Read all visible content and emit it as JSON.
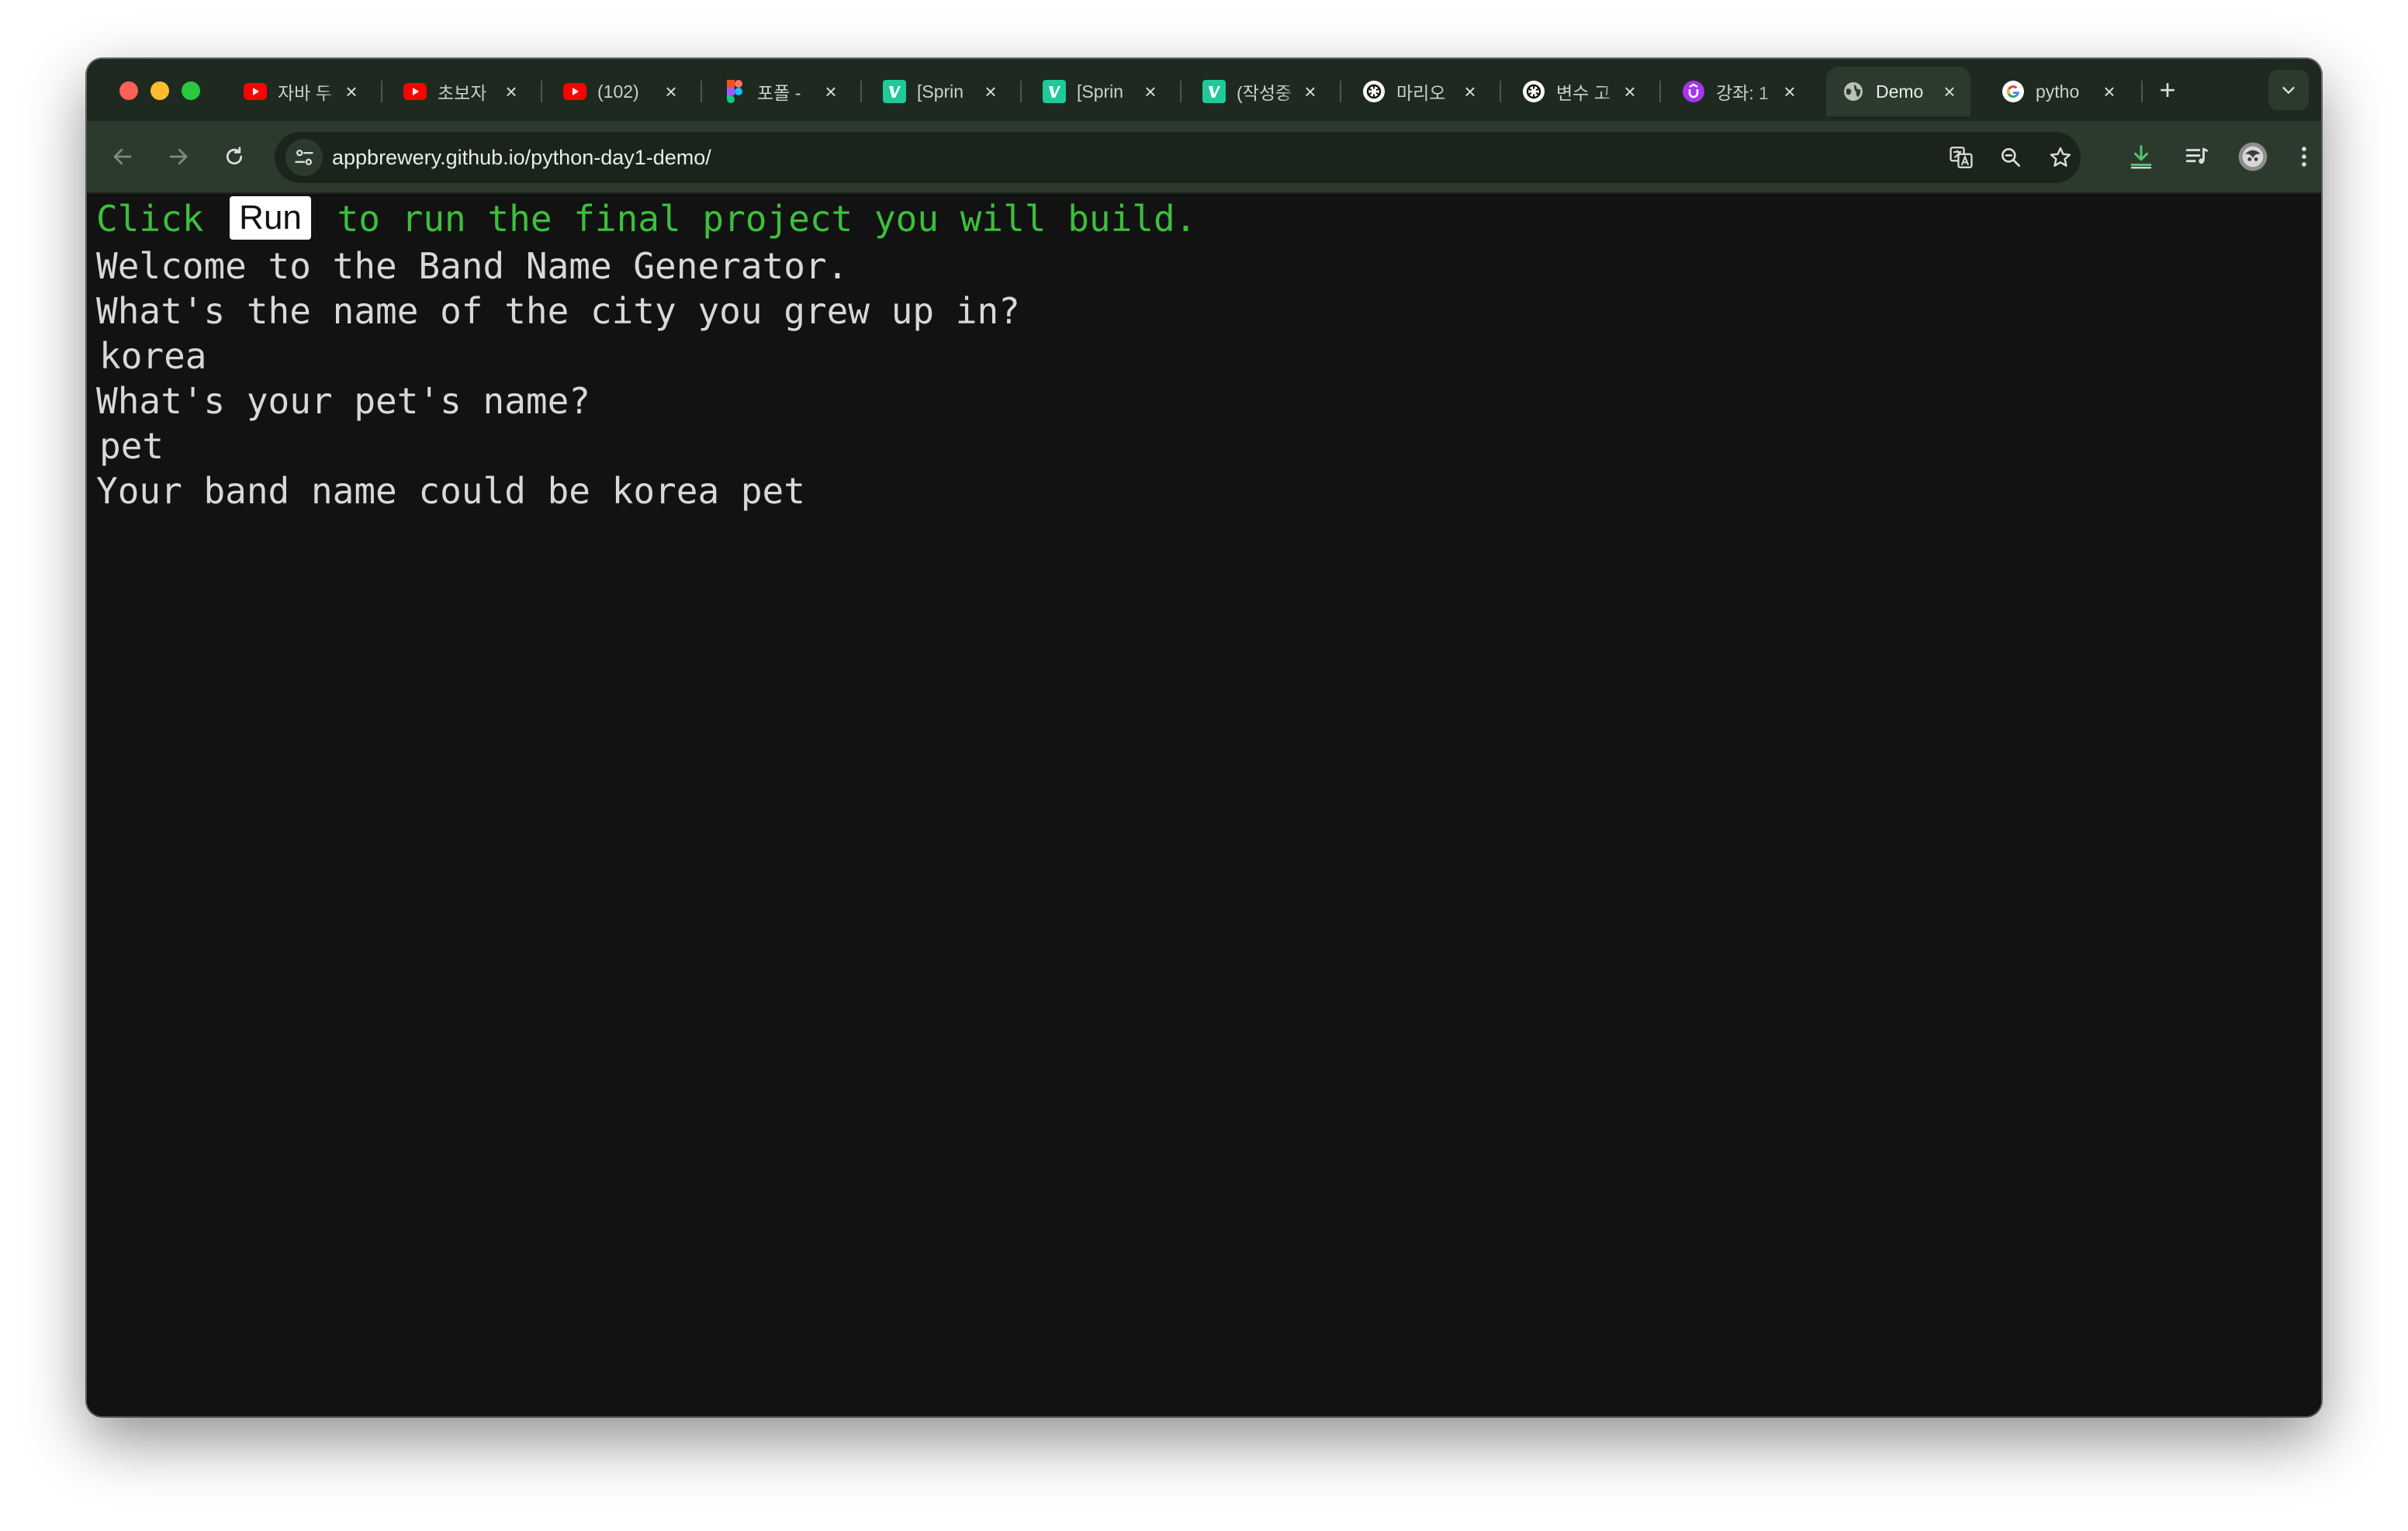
{
  "browser": {
    "tabs": [
      {
        "title": "자바 두",
        "favicon": "youtube-icon",
        "active": false
      },
      {
        "title": "초보자",
        "favicon": "youtube-icon",
        "active": false
      },
      {
        "title": "(102)",
        "favicon": "youtube-icon",
        "active": false
      },
      {
        "title": "포폴 -",
        "favicon": "figma-icon",
        "active": false
      },
      {
        "title": "[Sprin",
        "favicon": "velog-icon",
        "active": false
      },
      {
        "title": "[Sprin",
        "favicon": "velog-icon",
        "active": false
      },
      {
        "title": "(작성중",
        "favicon": "velog-icon",
        "active": false
      },
      {
        "title": "마리오",
        "favicon": "chatgpt-icon",
        "active": false
      },
      {
        "title": "변수 고",
        "favicon": "chatgpt-icon",
        "active": false
      },
      {
        "title": "강좌: 1",
        "favicon": "udemy-icon",
        "active": false
      },
      {
        "title": "Demo",
        "favicon": "globe-icon",
        "active": true
      },
      {
        "title": "pytho",
        "favicon": "google-icon",
        "active": false
      }
    ],
    "url": "appbrewery.github.io/python-day1-demo/"
  },
  "page": {
    "hint_before": "Click",
    "run_label": "Run",
    "hint_after": "to run the final project you will build.",
    "lines": [
      "Welcome to the Band Name Generator.",
      "What's the name of the city you grew up in?",
      "korea",
      "What's your pet's name?",
      "pet",
      "Your band name could be korea pet"
    ]
  },
  "colors": {
    "tab_strip": "#1e2a1f",
    "toolbar": "#2c3a2d",
    "page_bg": "#121212",
    "hint_text": "#3dbf3d",
    "terminal_text": "#d8d8d8"
  }
}
